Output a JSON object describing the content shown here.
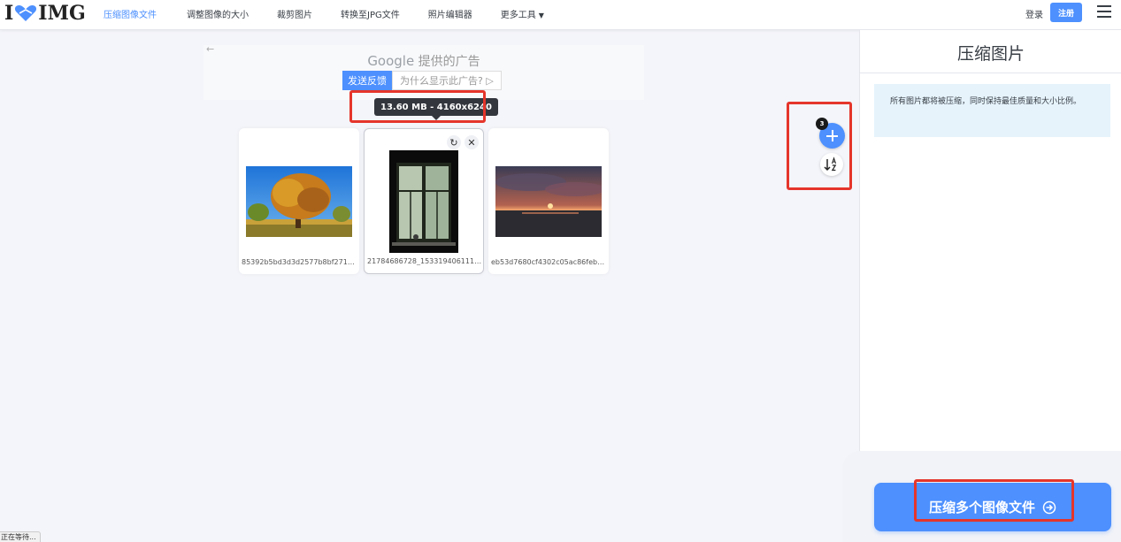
{
  "header": {
    "logo_text_left": "I",
    "logo_text_right": "IMG",
    "nav": [
      {
        "label": "压缩图像文件",
        "active": true
      },
      {
        "label": "调整图像的大小"
      },
      {
        "label": "裁剪图片"
      },
      {
        "label": "转换至JPG文件"
      },
      {
        "label": "照片编辑器"
      },
      {
        "label": "更多工具",
        "caret": "▼"
      }
    ],
    "login": "登录",
    "signup": "注册"
  },
  "ad": {
    "back": "←",
    "google": "Google",
    "provided": "提供的广告",
    "feedback": "发送反馈",
    "why": "为什么显示此广告?",
    "why_icon": "▷"
  },
  "tooltip": "13.60 MB - 4160x6240",
  "files": [
    {
      "name": "85392b5bd3d3d2577b8bf2717e…"
    },
    {
      "name": "21784686728_153319406111_p…"
    },
    {
      "name": "eb53d7680cf4302c05ac86febc5…"
    }
  ],
  "card_tools": {
    "rotate": "↻",
    "remove": "✕"
  },
  "add": {
    "badge": "3"
  },
  "sidebar": {
    "title": "压缩图片",
    "info": "所有图片都将被压缩，同时保持最佳质量和大小比例。",
    "button": "压缩多个图像文件"
  },
  "status": "正在等待...",
  "colors": {
    "accent": "#4d90fe",
    "annotation": "#e5352b"
  }
}
